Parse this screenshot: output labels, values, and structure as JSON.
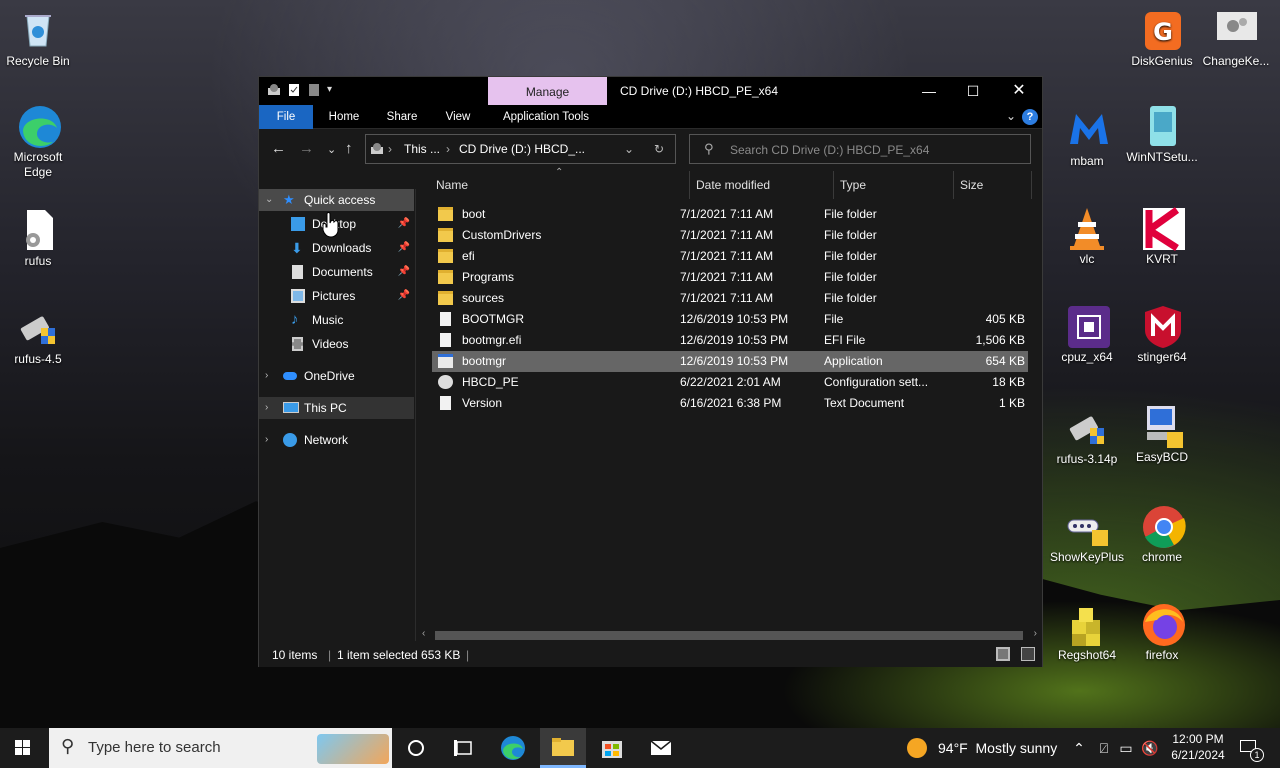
{
  "desktop": {
    "icons": [
      {
        "label": "Recycle Bin"
      },
      {
        "label": "Microsoft Edge"
      },
      {
        "label": "rufus"
      },
      {
        "label": "rufus-4.5"
      },
      {
        "label": "DiskGenius"
      },
      {
        "label": "ChangeKe..."
      },
      {
        "label": "mbam"
      },
      {
        "label": "WinNTSetu..."
      },
      {
        "label": "vlc"
      },
      {
        "label": "KVRT"
      },
      {
        "label": "cpuz_x64"
      },
      {
        "label": "stinger64"
      },
      {
        "label": "rufus-3.14p"
      },
      {
        "label": "EasyBCD"
      },
      {
        "label": "ShowKeyPlus"
      },
      {
        "label": "chrome"
      },
      {
        "label": "Regshot64"
      },
      {
        "label": "firefox"
      }
    ]
  },
  "window": {
    "title": "CD Drive (D:) HBCD_PE_x64",
    "manage_tab": "Manage",
    "ribbon_tabs": [
      "File",
      "Home",
      "Share",
      "View",
      "Application Tools"
    ],
    "address": {
      "crumb1": "This ...",
      "crumb2": "CD Drive (D:) HBCD_..."
    },
    "search_placeholder": "Search CD Drive (D:) HBCD_PE_x64",
    "nav": {
      "quick_access": "Quick access",
      "desktop": "Desktop",
      "downloads": "Downloads",
      "documents": "Documents",
      "pictures": "Pictures",
      "music": "Music",
      "videos": "Videos",
      "onedrive": "OneDrive",
      "this_pc": "This PC",
      "network": "Network"
    },
    "columns": {
      "name": "Name",
      "date": "Date modified",
      "type": "Type",
      "size": "Size"
    },
    "files": [
      {
        "name": "boot",
        "date": "7/1/2021 7:11 AM",
        "type": "File folder",
        "size": ""
      },
      {
        "name": "CustomDrivers",
        "date": "7/1/2021 7:11 AM",
        "type": "File folder",
        "size": ""
      },
      {
        "name": "efi",
        "date": "7/1/2021 7:11 AM",
        "type": "File folder",
        "size": ""
      },
      {
        "name": "Programs",
        "date": "7/1/2021 7:11 AM",
        "type": "File folder",
        "size": ""
      },
      {
        "name": "sources",
        "date": "7/1/2021 7:11 AM",
        "type": "File folder",
        "size": ""
      },
      {
        "name": "BOOTMGR",
        "date": "12/6/2019 10:53 PM",
        "type": "File",
        "size": "405 KB"
      },
      {
        "name": "bootmgr.efi",
        "date": "12/6/2019 10:53 PM",
        "type": "EFI File",
        "size": "1,506 KB"
      },
      {
        "name": "bootmgr",
        "date": "12/6/2019 10:53 PM",
        "type": "Application",
        "size": "654 KB"
      },
      {
        "name": "HBCD_PE",
        "date": "6/22/2021 2:01 AM",
        "type": "Configuration sett...",
        "size": "18 KB"
      },
      {
        "name": "Version",
        "date": "6/16/2021 6:38 PM",
        "type": "Text Document",
        "size": "1 KB"
      }
    ],
    "status": {
      "count": "10 items",
      "selected": "1 item selected  653 KB"
    }
  },
  "taskbar": {
    "search_placeholder": "Type here to search",
    "weather": "94°F  Mostly sunny",
    "time": "12:00 PM",
    "date": "6/21/2024",
    "notif_count": "1"
  }
}
